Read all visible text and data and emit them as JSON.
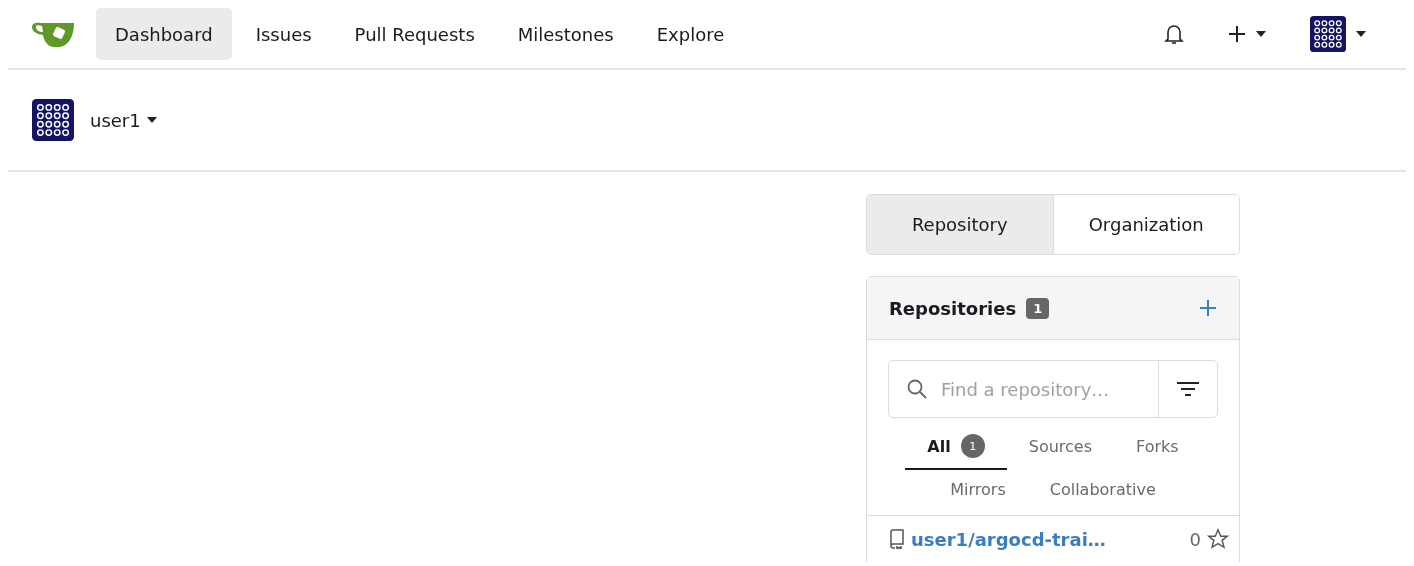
{
  "nav": {
    "items": [
      {
        "label": "Dashboard",
        "selected": true
      },
      {
        "label": "Issues",
        "selected": false
      },
      {
        "label": "Pull Requests",
        "selected": false
      },
      {
        "label": "Milestones",
        "selected": false
      },
      {
        "label": "Explore",
        "selected": false
      }
    ]
  },
  "context": {
    "user": "user1",
    "expanded": false
  },
  "switch": [
    {
      "label": "Repository",
      "selected": true
    },
    {
      "label": "Organization",
      "selected": false
    }
  ],
  "repositories": {
    "title": "Repositories",
    "count": "1",
    "search": {
      "placeholder": "Find a repository…"
    },
    "filters": [
      {
        "label": "All",
        "count": "1",
        "selected": true
      },
      {
        "label": "Sources",
        "selected": false
      },
      {
        "label": "Forks",
        "selected": false
      },
      {
        "label": "Mirrors",
        "selected": false
      },
      {
        "label": "Collaborative",
        "selected": false
      }
    ],
    "items": [
      {
        "name": "user1/argocd-trai…",
        "stars": "0"
      }
    ]
  }
}
